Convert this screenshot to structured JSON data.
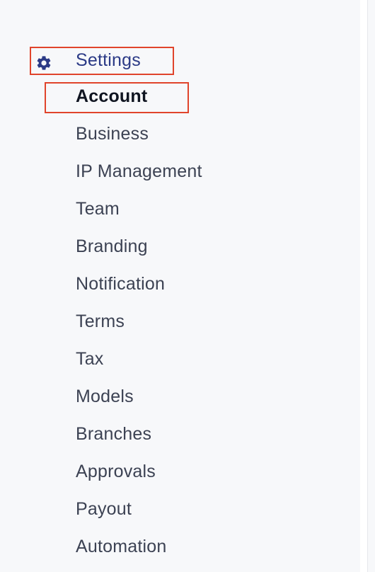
{
  "sidebar": {
    "section": {
      "icon": "gear-icon",
      "label": "Settings",
      "color": "#2b3a86"
    },
    "items": [
      {
        "label": "Account",
        "active": true
      },
      {
        "label": "Business"
      },
      {
        "label": "IP Management"
      },
      {
        "label": "Team"
      },
      {
        "label": "Branding"
      },
      {
        "label": "Notification"
      },
      {
        "label": "Terms"
      },
      {
        "label": "Tax"
      },
      {
        "label": "Models"
      },
      {
        "label": "Branches"
      },
      {
        "label": "Approvals"
      },
      {
        "label": "Payout"
      },
      {
        "label": "Automation"
      }
    ],
    "highlight_color": "#e0442b"
  }
}
